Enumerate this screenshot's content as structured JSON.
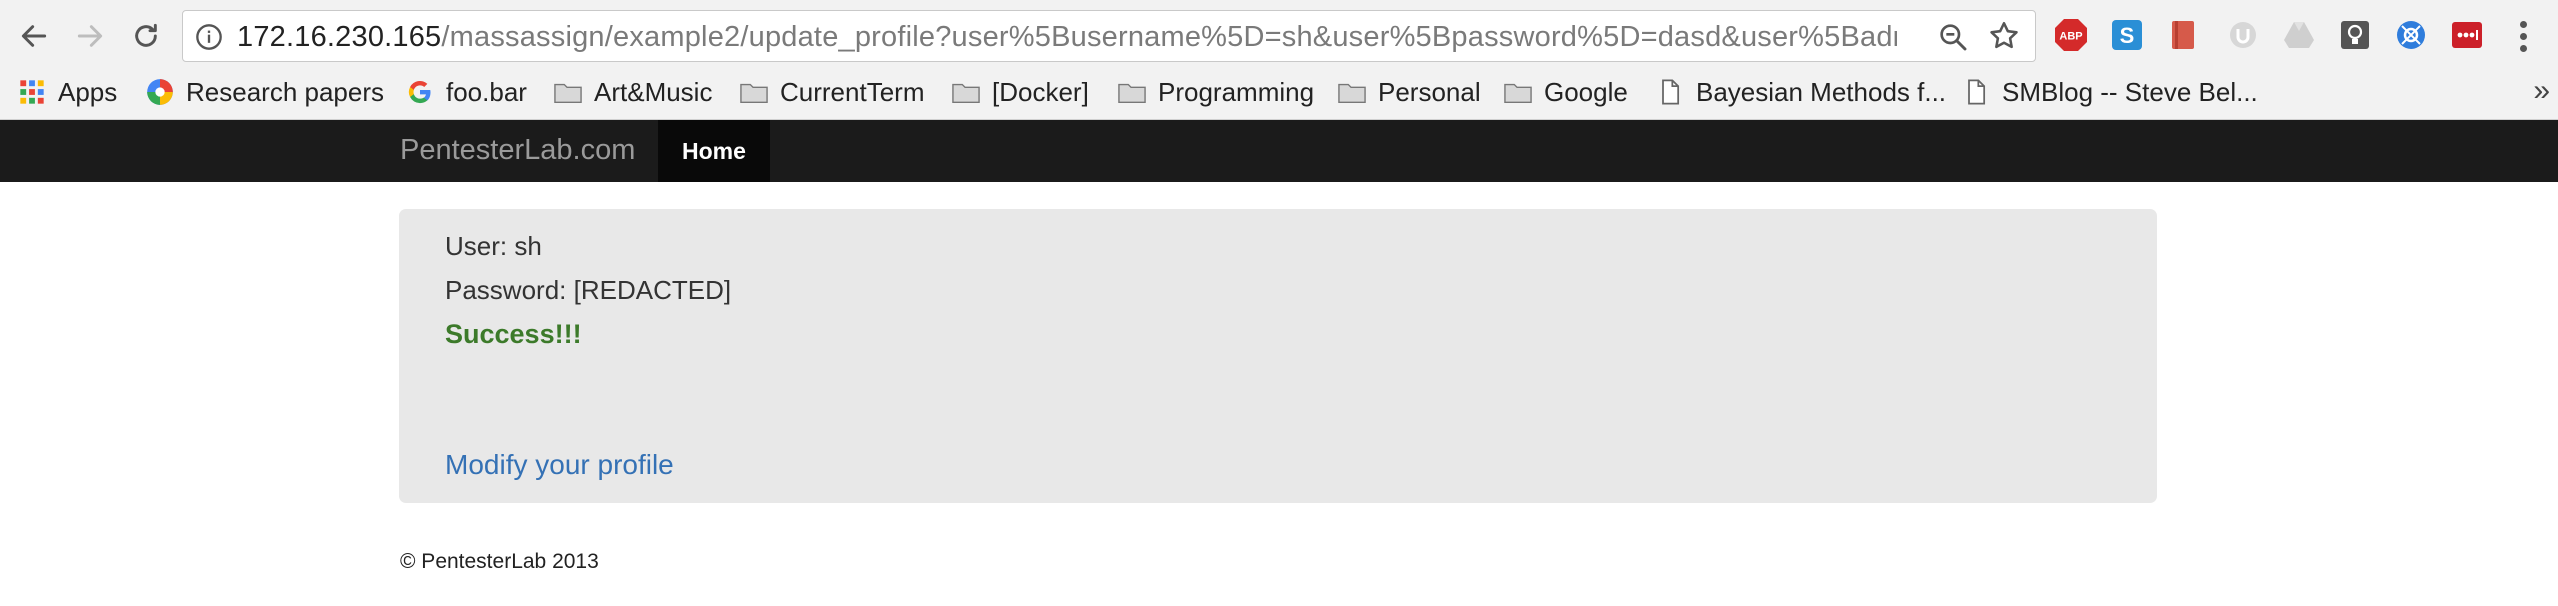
{
  "browser": {
    "url_host": "172.16.230.165",
    "url_path": "/massassign/example2/update_profile?user%5Busername%5D=sh&user%5Bpassword%5D=dasd&user%5Badm…"
  },
  "bookmarks": {
    "items": [
      {
        "label": "Apps",
        "icon": "apps-grid-icon"
      },
      {
        "label": "Research papers",
        "icon": "colorful-logo-icon"
      },
      {
        "label": "foo.bar",
        "icon": "google-g-icon"
      },
      {
        "label": "Art&Music",
        "icon": "folder-icon"
      },
      {
        "label": "CurrentTerm",
        "icon": "folder-icon"
      },
      {
        "label": "[Docker]",
        "icon": "folder-icon"
      },
      {
        "label": "Programming",
        "icon": "folder-icon"
      },
      {
        "label": "Personal",
        "icon": "folder-icon"
      },
      {
        "label": "Google",
        "icon": "folder-icon"
      },
      {
        "label": "Bayesian Methods f...",
        "icon": "page-icon"
      },
      {
        "label": "SMBlog -- Steve Bel...",
        "icon": "page-icon"
      }
    ],
    "overflow": "»"
  },
  "navbar": {
    "brand": "PentesterLab.com",
    "home": "Home"
  },
  "content": {
    "user_line": "User: sh",
    "password_line": "Password: [REDACTED]",
    "success": "Success!!!",
    "modify_link": "Modify your profile"
  },
  "footer": {
    "text": "© PentesterLab 2013"
  },
  "extensions": {
    "abp_label": "ABP",
    "s_label": "S"
  },
  "colors": {
    "navbar_bg": "#1b1b1b",
    "success_green": "#3c7a2a",
    "link_blue": "#3471b5",
    "well_bg": "#e8e8e8"
  }
}
